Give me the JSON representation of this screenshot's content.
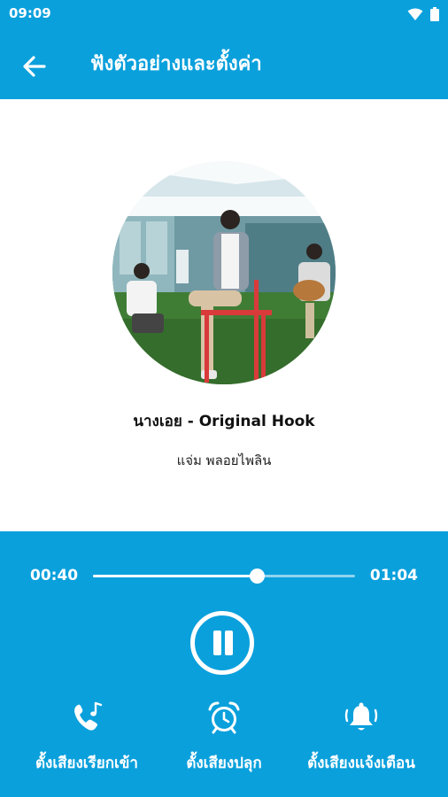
{
  "status_bar": {
    "time": "09:09"
  },
  "header": {
    "title": "ฟังตัวอย่างและตั้งค่า"
  },
  "song": {
    "title": "นางเอย - Original Hook",
    "artist": "แจ่ม พลอยไพลิน"
  },
  "player": {
    "current_time": "00:40",
    "total_time": "01:04",
    "progress": 0.625,
    "state": "playing"
  },
  "actions": [
    {
      "icon": "phone-music-icon",
      "label": "ตั้งเสียงเรียกเข้า"
    },
    {
      "icon": "alarm-clock-icon",
      "label": "ตั้งเสียงปลุก"
    },
    {
      "icon": "bell-icon",
      "label": "ตั้งเสียงแจ้งเตือน"
    }
  ],
  "colors": {
    "primary": "#0aa0dc",
    "text": "#111111"
  }
}
